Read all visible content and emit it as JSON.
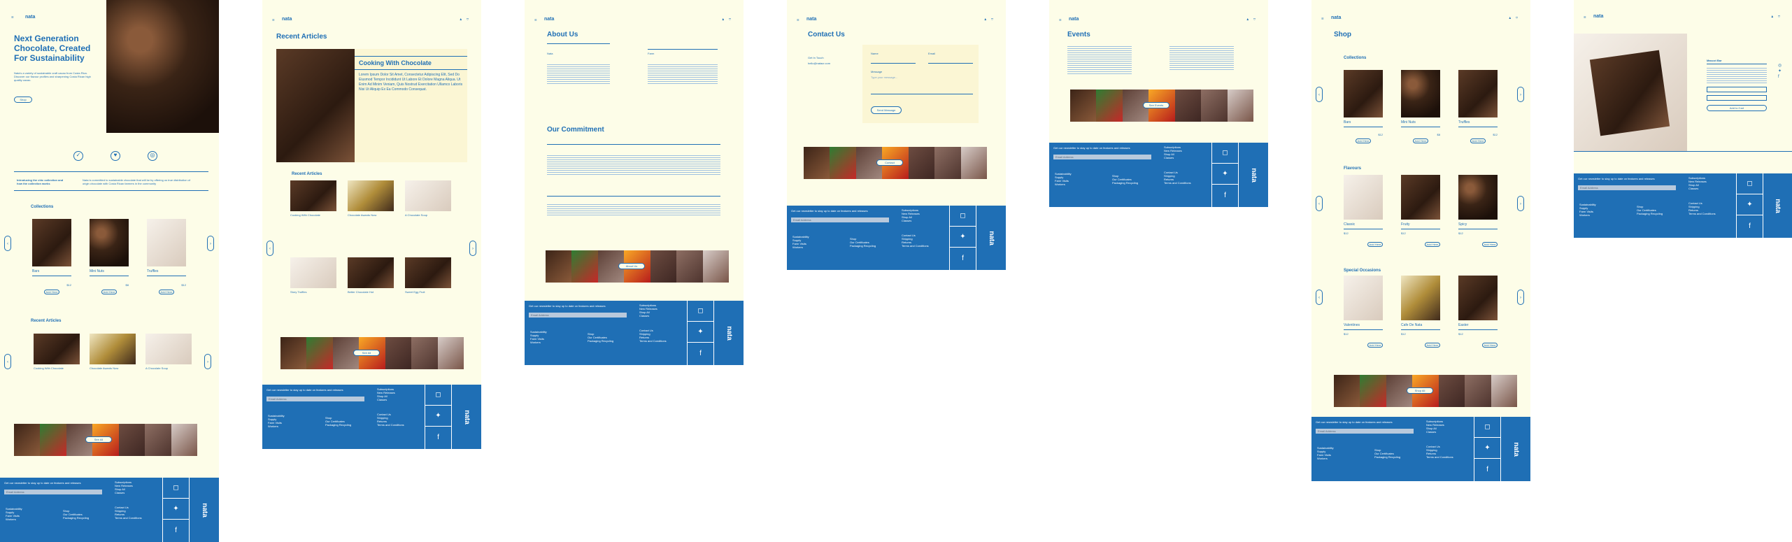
{
  "brand": {
    "name": "nata"
  },
  "home": {
    "hero_title": "Next Generation Chocolate, Created For Sustainability",
    "hero_text": "Nata's a variety of sustainable craft cacao from Costa Rica. Discover our flavour profiles and sharpening Costa Rican high quality cacao.",
    "hero_button": "Shop",
    "intro_left": "Introducing the chic collection and how the collection works",
    "intro_right": "Nata is committed to sustainable chocolate that will be by offering us true distribution of origin chocolate with Costa Rican farmers in the community",
    "collections_heading": "Collections",
    "collections": [
      {
        "name": "Bars",
        "price": "$12"
      },
      {
        "name": "Mini Nuts",
        "price": "$8"
      },
      {
        "name": "Truffles",
        "price": "$12"
      }
    ],
    "add_label": "Add Here",
    "recent_heading": "Recent Articles",
    "articles": [
      {
        "title": "Cooking With Chocolate"
      },
      {
        "title": "Chocolate Awards Now"
      },
      {
        "title": "A Chocolate Soup"
      }
    ],
    "strip_button": "See All"
  },
  "articles_page": {
    "title": "Recent Articles",
    "feature_title": "Cooking With Chocolate",
    "feature_text": "Lorem Ipsum Dolor Sit Amet, Consectetur Adipiscing Elit, Sed Do Eiusmod Tempor Incididunt Ut Labore Et Dolore Magna Aliqua. Ut Enim Ad Minim Veniam, Quis Nostrud Exercitation Ullamco Laboris Nisi Ut Aliquip Ex Ea Commodo Consequat.",
    "sub_heading": "Recent Articles",
    "list": [
      {
        "title": "Cooking With Chocolate"
      },
      {
        "title": "Chocolate Awards Now"
      },
      {
        "title": "A Chocolate Soup"
      },
      {
        "title": "Story Truffles"
      },
      {
        "title": "Better Chocolate Hot"
      },
      {
        "title": "Sweet Egg Fruit"
      }
    ],
    "strip_button": "See All"
  },
  "about": {
    "title": "About Us",
    "commitment": "Our Commitment",
    "sub_left": "Nata",
    "sub_right": "Farm",
    "strip_button": "About Us"
  },
  "contact": {
    "title": "Contact Us",
    "get_in_touch": "Get In Touch",
    "email": "hello@natacr.com",
    "name_label": "Name",
    "email_label": "Email",
    "message_label": "Message",
    "message_placeholder": "Type your message...",
    "send_label": "Send Message",
    "strip_button": "Contact"
  },
  "events": {
    "title": "Events",
    "strip_button": "See Events"
  },
  "shop": {
    "title": "Shop",
    "collections_heading": "Collections",
    "collections": [
      {
        "name": "Bars",
        "price": "$12"
      },
      {
        "name": "Mini Nuts",
        "price": "$8"
      },
      {
        "name": "Truffles",
        "price": "$12"
      }
    ],
    "flavours_heading": "Flavours",
    "flavours": [
      {
        "name": "Classic",
        "price": "$12"
      },
      {
        "name": "Fruity",
        "price": "$12"
      },
      {
        "name": "Spicy",
        "price": "$12"
      }
    ],
    "special_heading": "Special Occasions",
    "special": [
      {
        "name": "Valentines",
        "price": "$12"
      },
      {
        "name": "Cafe De Nata",
        "price": "$12"
      },
      {
        "name": "Easter",
        "price": "$12"
      }
    ],
    "add_label": "Add Here",
    "strip_button": "Shop All"
  },
  "product": {
    "title": "Mascot Bar",
    "cart_label": "Add to Cart"
  },
  "footer": {
    "newsletter": "Get our newsletter to stay up to date on features and releases",
    "search_placeholder": "Email Address",
    "col1": [
      "Sustainability",
      "Supply",
      "Farm Visits",
      "Workers"
    ],
    "col2": [
      "Shop",
      "Our Certificates",
      "Packaging Recycling"
    ],
    "col3": [
      "Subscriptions",
      "New Releases",
      "Shop All",
      "Classes"
    ],
    "col4": [
      "Contact Us",
      "Shipping",
      "Returns",
      "Terms and Conditions"
    ],
    "social": [
      "instagram",
      "twitter",
      "facebook"
    ]
  }
}
